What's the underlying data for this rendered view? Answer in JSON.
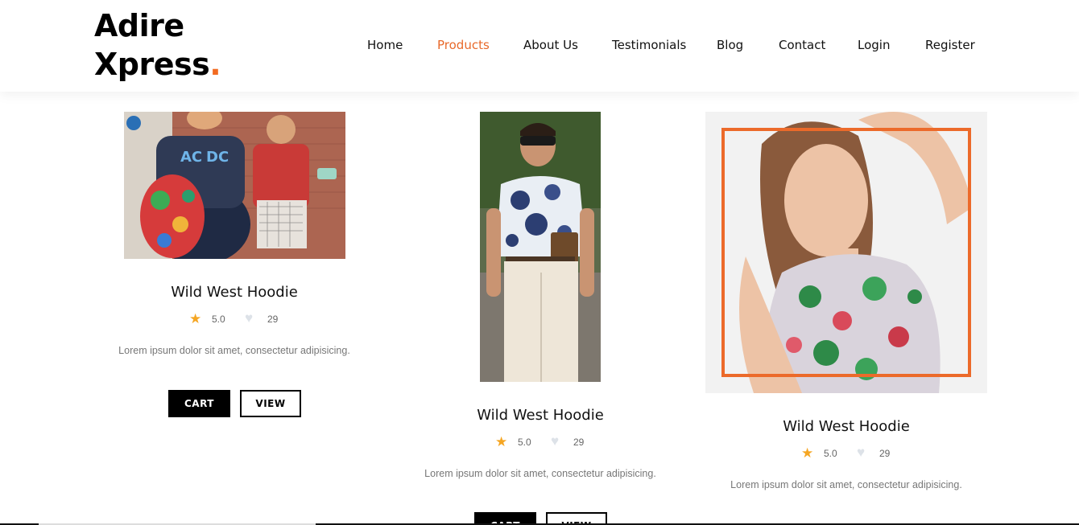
{
  "brand": {
    "line1": "Adire",
    "line2": "Xpress",
    "dot": ".",
    "accent": "#f26b21"
  },
  "nav": {
    "items": [
      {
        "label": "Home"
      },
      {
        "label": "Products",
        "active": true
      },
      {
        "label": "About Us"
      },
      {
        "label": "Testimonials"
      },
      {
        "label": "Blog"
      },
      {
        "label": "Contact"
      },
      {
        "label": "Login"
      },
      {
        "label": "Register"
      }
    ]
  },
  "products": [
    {
      "image": "street-style-women-photo",
      "title": "Wild West Hoodie",
      "rating": "5.0",
      "likes": "29",
      "description": "Lorem ipsum dolor sit amet, consectetur adipisicing.",
      "cart_label": "CART",
      "view_label": "VIEW"
    },
    {
      "image": "man-tie-dye-shirt-photo",
      "title": "Wild West Hoodie",
      "rating": "5.0",
      "likes": "29",
      "description": "Lorem ipsum dolor sit amet, consectetur adipisicing.",
      "cart_label": "CART",
      "view_label": "VIEW"
    },
    {
      "image": "woman-floral-top-photo",
      "title": "Wild West Hoodie",
      "rating": "5.0",
      "likes": "29",
      "description": "Lorem ipsum dolor sit amet, consectetur adipisicing."
    }
  ],
  "icons": {
    "rating": "star-icon",
    "likes": "heart-icon"
  },
  "colors": {
    "accent": "#e8692a",
    "star": "#f5a623",
    "button": "#000000"
  }
}
